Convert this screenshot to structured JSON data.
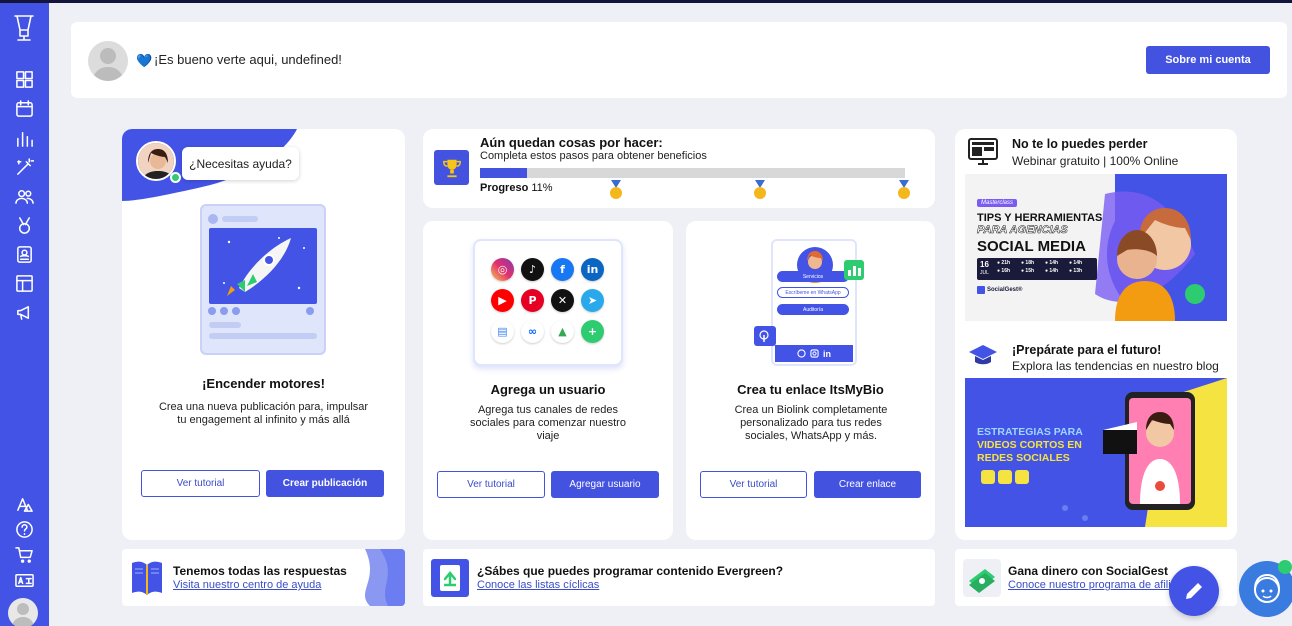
{
  "header": {
    "greeting_emoji": "💙",
    "greeting": "¡Es bueno verte aqui, undefined!",
    "account_button": "Sobre mi cuenta"
  },
  "rocket_card": {
    "help_bubble": "¿Necesitas ayuda?",
    "title": "¡Encender motores!",
    "description": "Crea una nueva publicación para, impulsar tu engagement al infinito y más allá",
    "tutorial_button": "Ver tutorial",
    "action_button": "Crear publicación"
  },
  "progress": {
    "title": "Aún quedan cosas por hacer:",
    "subtitle": "Completa estos pasos para obtener beneficios",
    "label": "Progreso",
    "value_text": "11%",
    "value": 0.11,
    "accent": "#4353e0",
    "track": "#d8d8d8"
  },
  "user_card": {
    "title": "Agrega un usuario",
    "description": "Agrega tus canales de redes sociales para comenzar nuestro viaje",
    "tutorial_button": "Ver tutorial",
    "action_button": "Agregar usuario",
    "social_icons": [
      "instagram-icon",
      "tiktok-icon",
      "facebook-icon",
      "linkedin-icon",
      "youtube-icon",
      "pinterest-icon",
      "x-icon",
      "telegram-icon",
      "google-business-icon",
      "meta-icon",
      "google-drive-icon",
      "add-icon"
    ]
  },
  "bio_card": {
    "title": "Crea tu enlace ItsMyBio",
    "description": "Crea un Biolink completamente personalizado para tus redes sociales, WhatsApp y más.",
    "tutorial_button": "Ver tutorial",
    "action_button": "Crear enlace",
    "mock_links": [
      "Servicios",
      "Escríbeme en WhatsApp",
      "Auditoría"
    ]
  },
  "webinar": {
    "title": "No te lo puedes perder",
    "subtitle": "Webinar gratuito | 100% Online",
    "banner": {
      "tag": "Masterclass",
      "line1": "TIPS Y HERRAMIENTAS",
      "line2": "PARA AGENCIAS",
      "line3": "SOCIAL MEDIA",
      "date_day": "16",
      "date_month": "JUL",
      "times": [
        "21h",
        "18h",
        "14h",
        "14h",
        "16h",
        "15h",
        "14h",
        "13h"
      ],
      "brand": "SocialGest®"
    }
  },
  "blog": {
    "title": "¡Prepárate para el futuro!",
    "subtitle": "Explora las tendencias en nuestro blog",
    "banner": {
      "line1": "ESTRATEGIAS PARA",
      "line2": "VIDEOS CORTOS EN",
      "line3": "REDES SOCIALES"
    }
  },
  "help_strip": {
    "title": "Tenemos todas las respuestas",
    "link": "Visita nuestro centro de ayuda"
  },
  "evergreen_strip": {
    "title": "¿Sábes que puedes programar contenido Evergreen?",
    "link": "Conoce las listas cíclicas"
  },
  "money_strip": {
    "title": "Gana dinero con SocialGest",
    "link": "Conoce nuestro programa de afili"
  },
  "colors": {
    "sidebar": "#4353e6",
    "background": "#eef0f6",
    "primary": "#4353e0"
  }
}
